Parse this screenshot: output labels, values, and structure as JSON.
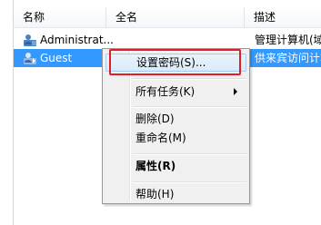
{
  "list": {
    "columns": [
      "名称",
      "全名",
      "描述"
    ],
    "rows": [
      {
        "name": "Administrat...",
        "full_name": "",
        "description": "管理计算机(域",
        "icon": "user-icon",
        "selected": false
      },
      {
        "name": "Guest",
        "full_name": "",
        "description": "供来宾访问计算",
        "icon": "guest-user-icon",
        "selected": true
      }
    ]
  },
  "context_menu": {
    "items": [
      {
        "label": "设置密码(S)...",
        "highlighted": true,
        "bold": false,
        "has_submenu": false
      },
      {
        "label": "所有任务(K)",
        "highlighted": false,
        "bold": false,
        "has_submenu": true
      },
      {
        "label": "删除(D)",
        "highlighted": false,
        "bold": false,
        "has_submenu": false
      },
      {
        "label": "重命名(M)",
        "highlighted": false,
        "bold": false,
        "has_submenu": false
      },
      {
        "label": "属性(R)",
        "highlighted": false,
        "bold": true,
        "has_submenu": false
      },
      {
        "label": "帮助(H)",
        "highlighted": false,
        "bold": false,
        "has_submenu": false
      }
    ]
  },
  "colors": {
    "selection": "#3399ff",
    "focus_box": "#e11e26"
  }
}
